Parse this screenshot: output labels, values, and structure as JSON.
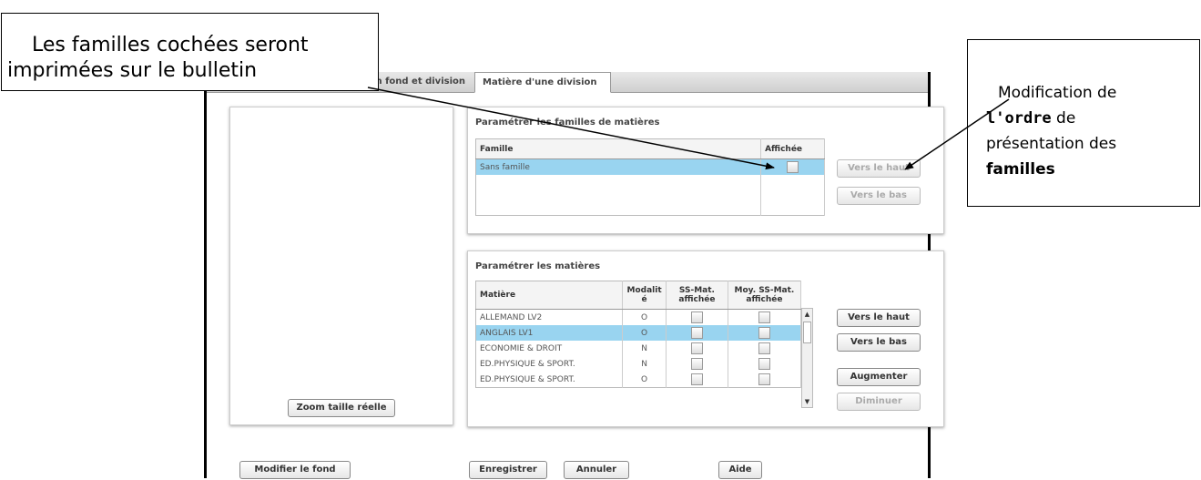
{
  "tabs": [
    {
      "label": "n fond et division"
    },
    {
      "label": "Matière d'une division"
    }
  ],
  "left_panel": {
    "zoom_button": "Zoom taille réelle"
  },
  "families": {
    "title": "Paramétrer les familles de matières",
    "columns": [
      "Famille",
      "Affichée"
    ],
    "rows": [
      {
        "name": "Sans famille",
        "selected": true
      }
    ],
    "buttons": {
      "up": "Vers le haut",
      "down": "Vers le bas"
    }
  },
  "subjects": {
    "title": "Paramétrer les matières",
    "columns": [
      "Matière",
      "Modalit é",
      "SS-Mat. affichée",
      "Moy. SS-Mat. affichée"
    ],
    "rows": [
      {
        "name": "ALLEMAND LV2",
        "mod": "O",
        "selected": false
      },
      {
        "name": "ANGLAIS LV1",
        "mod": "O",
        "selected": true
      },
      {
        "name": "ECONOMIE & DROIT",
        "mod": "N",
        "selected": false
      },
      {
        "name": "ED.PHYSIQUE & SPORT.",
        "mod": "N",
        "selected": false
      },
      {
        "name": "ED.PHYSIQUE & SPORT.",
        "mod": "O",
        "selected": false
      }
    ],
    "buttons": {
      "up": "Vers le haut",
      "down": "Vers le bas",
      "increase": "Augmenter",
      "decrease": "Diminuer"
    }
  },
  "footer": {
    "modify": "Modifier le fond",
    "save": "Enregistrer",
    "cancel": "Annuler",
    "help": "Aide"
  },
  "callouts": {
    "left": {
      "line1": "Les familles cochées seront",
      "line2": "imprimées sur le bulletin"
    },
    "right": {
      "line1": "Modification de",
      "line2_bold": "l'ordre",
      "line2_rest": " de",
      "line3": "présentation des",
      "line4_bold": "familles"
    }
  },
  "colors": {
    "selection": "#99d4f0",
    "border": "#000000"
  }
}
